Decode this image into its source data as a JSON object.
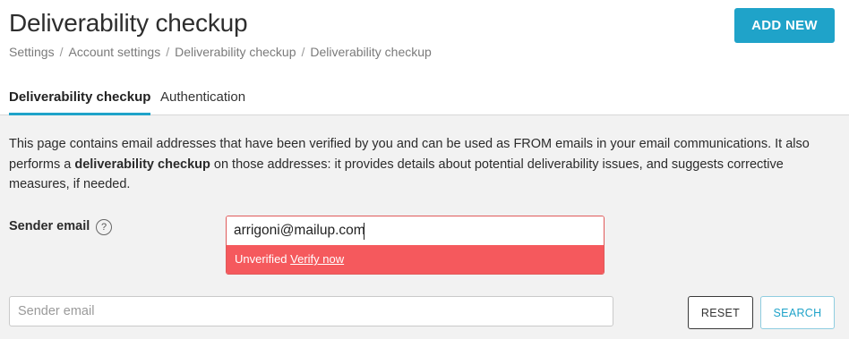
{
  "header": {
    "title": "Deliverability checkup",
    "add_new_label": "ADD NEW"
  },
  "breadcrumb": [
    "Settings",
    "Account settings",
    "Deliverability checkup",
    "Deliverability checkup"
  ],
  "breadcrumb_separator": "/",
  "tabs": [
    {
      "label": "Deliverability checkup",
      "active": true
    },
    {
      "label": "Authentication",
      "active": false
    }
  ],
  "description": {
    "part1": "This page contains email addresses that have been verified by you and can be used as FROM emails in your email communications. It also performs a ",
    "bold": "deliverability checkup",
    "part2": " on those addresses: it provides details about potential deliverability issues, and suggests corrective measures, if needed."
  },
  "sender": {
    "label": "Sender email",
    "help_icon": "question-circle-icon",
    "value": "arrigoni@mailup.com",
    "status": "Unverified",
    "verify_label": "Verify now"
  },
  "filter": {
    "placeholder": "Sender email",
    "reset_label": "RESET",
    "search_label": "SEARCH"
  },
  "colors": {
    "accent": "#1fa3c9",
    "error": "#f5595d",
    "background": "#f2f2f2"
  }
}
